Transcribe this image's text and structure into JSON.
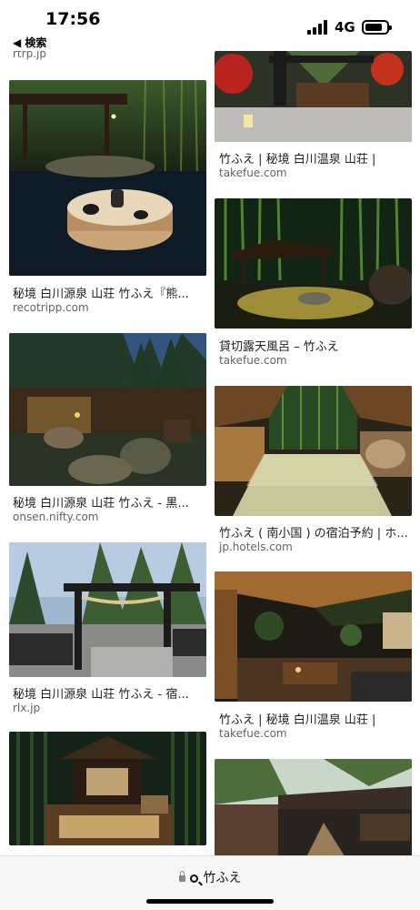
{
  "status_bar": {
    "time": "17:56",
    "back_label": "◀ 検索",
    "network": "4G"
  },
  "results": [
    {
      "id": "r0",
      "title": "",
      "domain": "rtrp.jp"
    },
    {
      "id": "r1",
      "title": "秘境 白川源泉 山荘 竹ふえ『熊...",
      "domain": "recotripp.com"
    },
    {
      "id": "r2",
      "title": "秘境 白川源泉 山荘 竹ふえ - 黒...",
      "domain": "onsen.nifty.com"
    },
    {
      "id": "r3",
      "title": "秘境 白川源泉 山荘 竹ふえ - 宿...",
      "domain": "rlx.jp"
    },
    {
      "id": "r5",
      "title": "竹ふえ | 秘境 白川温泉 山荘 |",
      "domain": "takefue.com"
    },
    {
      "id": "r6",
      "title": "貸切露天風呂 – 竹ふえ",
      "domain": "takefue.com"
    },
    {
      "id": "r7",
      "title": "竹ふえ ( 南小国 ) の宿泊予約 | ホ...",
      "domain": "jp.hotels.com"
    },
    {
      "id": "r8",
      "title": "竹ふえ | 秘境 白川温泉 山荘 |",
      "domain": "takefue.com"
    }
  ],
  "address_bar": {
    "query": "竹ふえ"
  }
}
